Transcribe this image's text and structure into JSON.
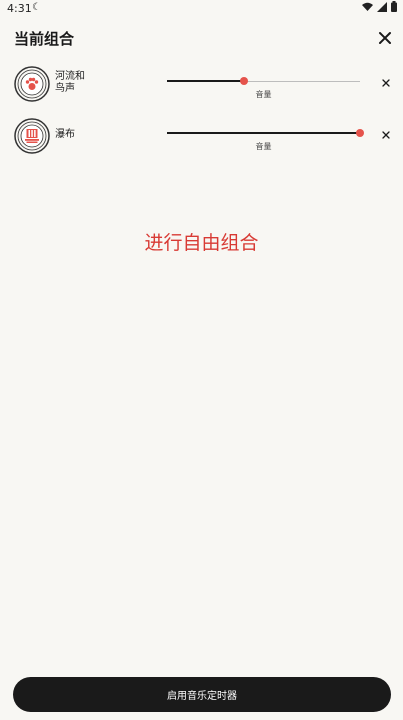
{
  "status_bar": {
    "time": "4:31",
    "moon_icon": "moon-icon",
    "icons": [
      "wifi-icon",
      "signal-icon",
      "battery-icon"
    ]
  },
  "header": {
    "title": "当前组合",
    "close_icon": "close-icon"
  },
  "sounds": [
    {
      "name_line1": "河流和",
      "name_line2": "鸟声",
      "icon": "paw-icon",
      "volume_label": "音量",
      "volume": 0.4
    },
    {
      "name_line1": "瀑布",
      "name_line2": "",
      "icon": "waterfall-icon",
      "volume_label": "音量",
      "volume": 1.0
    }
  ],
  "overlay_text": "进行自由组合",
  "footer": {
    "button_label": "启用音乐定时器"
  },
  "colors": {
    "accent": "#e5534b",
    "button_bg": "#1a1a1a",
    "background": "#f8f7f3",
    "overlay_text": "#d83a34"
  }
}
